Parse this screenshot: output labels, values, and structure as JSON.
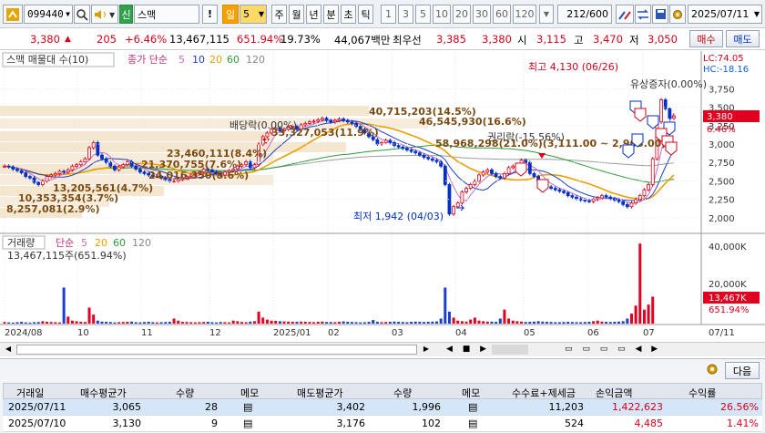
{
  "toolbar": {
    "stock_code": "099440",
    "stock_name": "스맥",
    "credit_badge": "신",
    "period_selected": "일",
    "period_value": "5",
    "period_tabs": [
      "주",
      "월",
      "년",
      "분",
      "초",
      "틱"
    ],
    "interval_tabs": [
      "1",
      "3",
      "5",
      "10",
      "20",
      "30",
      "60",
      "120"
    ],
    "count": "212",
    "count_total": "/600",
    "date": "2025/07/11"
  },
  "quote": {
    "price": "3,380",
    "change": "205",
    "change_pct": "+6.46%",
    "volume": "13,467,115",
    "volume_ratio": "651.94%",
    "turnover": "19.73%",
    "amount": "44,067백만",
    "best_bid_label": "최우선",
    "ask": "3,385",
    "bid": "3,380",
    "open_label": "시",
    "open": "3,115",
    "high_label": "고",
    "high": "3,470",
    "low_label": "저",
    "low": "3,050",
    "buy_label": "매수",
    "sell_label": "매도"
  },
  "price_chart": {
    "title": "스맥 매물대 수(10)",
    "ma_label": "종가 단순",
    "ma_periods": [
      "5",
      "10",
      "20",
      "60",
      "120"
    ],
    "lc": "LC:74.05",
    "hc": "HC:-18.16",
    "y_ticks": [
      "3,750",
      "3,500",
      "3,250",
      "3,000",
      "2,750",
      "2,500",
      "2,250",
      "2,000"
    ],
    "current_price": "3,380",
    "current_pct": "6.46%",
    "annotations": {
      "high": "최고 4,130 (06/26)",
      "low": "최저 1,942 (04/03)",
      "rights_issue": "유상증자(0.00%)",
      "dividend": "배당락(0.00%)",
      "rights_off": "권리락(-15.56%)",
      "vp1": "40,715,203(14.5%)",
      "vp2": "46,545,930(16.6%)",
      "vp3": "58,968,298(21.0%)(3,111.00 ~ 2,963.00)",
      "vp4": "23,460,111(8.4%)",
      "vp5": "21,370,755(7.6%)",
      "vp6": "24,016,350(8.6%)",
      "vp7": "13,205,561(4.7%)",
      "vp8": "10,353,354(3.7%)",
      "vp9": "8,257,081(2.9%)",
      "vp10": "33,327,053(11.9%)"
    }
  },
  "volume_chart": {
    "title": "거래량",
    "ma_label": "단순",
    "ma_periods": [
      "5",
      "20",
      "60",
      "120"
    ],
    "volume_text": "13,467,115주(651.94%)",
    "y_ticks": [
      "40,000K",
      "20,000K"
    ],
    "current": "13,467K",
    "current_pct": "651.94%"
  },
  "x_axis": {
    "labels": [
      "2024/08",
      "10",
      "11",
      "12",
      "2025/01",
      "02",
      "03",
      "04",
      "05",
      "06",
      "07"
    ],
    "end_date": "07/11"
  },
  "grid": {
    "next_button": "다음",
    "headers": [
      "거래일",
      "매수평균가",
      "수량",
      "메모",
      "매도평균가",
      "수량",
      "메모",
      "수수료+제세금",
      "손익금액",
      "수익률"
    ],
    "rows": [
      {
        "date": "2025/07/11",
        "buy_avg": "3,065",
        "buy_qty": "28",
        "sell_avg": "3,402",
        "sell_qty": "1,996",
        "fee": "11,203",
        "profit": "1,422,623",
        "rate": "26.56%"
      },
      {
        "date": "2025/07/10",
        "buy_avg": "3,130",
        "buy_qty": "9",
        "sell_avg": "3,176",
        "sell_qty": "102",
        "fee": "524",
        "profit": "4,485",
        "rate": "1.41%"
      }
    ]
  },
  "chart_data": {
    "type": "candlestick",
    "y_price_range": [
      1850,
      4200
    ],
    "closes": [
      2700,
      2690,
      2660,
      2640,
      2610,
      2560,
      2540,
      2480,
      2450,
      2500,
      2560,
      2580,
      2600,
      2630,
      2620,
      2650,
      2700,
      2720,
      2760,
      2800,
      2950,
      3020,
      2850,
      2800,
      2750,
      2700,
      2650,
      2690,
      2720,
      2760,
      2700,
      2660,
      2620,
      2600,
      2580,
      2560,
      2560,
      2540,
      2520,
      2500,
      2500,
      2520,
      2540,
      2560,
      2580,
      2600,
      2620,
      2660,
      2650,
      2620,
      2600,
      2580,
      2620,
      2640,
      2660,
      2700,
      2720,
      2760,
      2680,
      2720,
      3000,
      3100,
      3150,
      3200,
      3220,
      3180,
      3200,
      3230,
      3240,
      3200,
      3260,
      3280,
      3300,
      3310,
      3330,
      3350,
      3320,
      3300,
      3320,
      3340,
      3320,
      3300,
      3280,
      3240,
      3200,
      3150,
      3100,
      3060,
      3000,
      3020,
      3050,
      3020,
      2980,
      2960,
      2940,
      2920,
      2900,
      2880,
      2850,
      2820,
      2800,
      2780,
      2760,
      2700,
      2450,
      2050,
      2150,
      2200,
      2350,
      2400,
      2450,
      2500,
      2580,
      2620,
      2650,
      2600,
      2560,
      2540,
      2600,
      2680,
      2700,
      2720,
      2780,
      2750,
      2600,
      2560,
      2500,
      2450,
      2420,
      2400,
      2380,
      2360,
      2340,
      2300,
      2280,
      2260,
      2240,
      2230,
      2220,
      2250,
      2270,
      2300,
      2280,
      2260,
      2240,
      2220,
      2180,
      2150,
      2200,
      2250,
      2300,
      2380,
      2450,
      2800,
      3300,
      3600,
      3480,
      3350,
      3380
    ],
    "volumes_k": [
      800,
      600,
      500,
      700,
      900,
      600,
      500,
      700,
      800,
      1200,
      900,
      800,
      700,
      600,
      18000,
      3500,
      1500,
      1200,
      900,
      800,
      8000,
      4500,
      1500,
      1000,
      900,
      800,
      600,
      700,
      800,
      900,
      1000,
      700,
      600,
      800,
      900,
      700,
      600,
      700,
      800,
      900,
      2500,
      1500,
      900,
      800,
      700,
      600,
      700,
      800,
      900,
      700,
      600,
      800,
      700,
      600,
      1500,
      1200,
      800,
      700,
      1000,
      1200,
      6000,
      3000,
      2000,
      1500,
      1400,
      1200,
      1100,
      1000,
      900,
      900,
      1000,
      900,
      800,
      700,
      900,
      1000,
      800,
      800,
      700,
      900,
      1100,
      900,
      800,
      700,
      600,
      700,
      900,
      1800,
      900,
      700,
      800,
      900,
      1000,
      900,
      800,
      700,
      900,
      1000,
      900,
      800,
      900,
      1000,
      1100,
      2500,
      18000,
      6000,
      3000,
      1500,
      1200,
      1000,
      2000,
      3000,
      1500,
      1200,
      1000,
      1000,
      900,
      2500,
      7000,
      2500,
      1500,
      1200,
      1000,
      800,
      900,
      1000,
      1200,
      1000,
      900,
      800,
      700,
      700,
      800,
      900,
      800,
      700,
      700,
      800,
      900,
      1200,
      1500,
      1000,
      900,
      800,
      900,
      1000,
      1200,
      2500,
      5000,
      9000,
      40000,
      7000,
      9500,
      13467
    ]
  }
}
